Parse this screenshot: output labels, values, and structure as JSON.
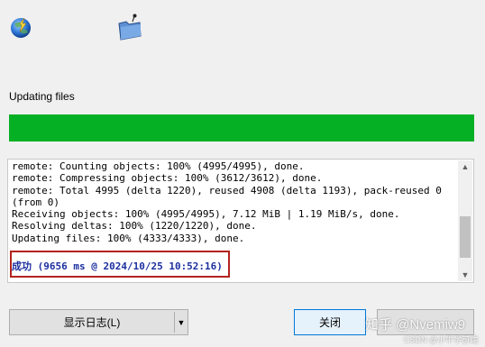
{
  "header": {
    "icons": [
      "tortoise-git-globe-icon",
      "remote-folder-icon"
    ]
  },
  "status": {
    "label": "Updating files",
    "progress_fraction": 1.0,
    "progress_color": "#06b025"
  },
  "log": {
    "lines": [
      "remote: Counting objects: 100% (4995/4995), done.",
      "remote: Compressing objects: 100% (3612/3612), done.",
      "remote: Total 4995 (delta 1220), reused 4908 (delta 1193), pack-reused 0",
      "(from 0)",
      "Receiving objects: 100% (4995/4995), 7.12 MiB | 1.19 MiB/s, done.",
      "Resolving deltas: 100% (1220/1220), done.",
      "Updating files: 100% (4333/4333), done."
    ],
    "success_line": "成功 (9656 ms @ 2024/10/25 10:52:16)",
    "success_color": "#1b2fa0",
    "highlight_color": "#b3221e"
  },
  "buttons": {
    "show_log": "显示日志(L)",
    "close": "关闭"
  },
  "watermark": {
    "main": "知乎 @Nvemiw9",
    "sub": "CSDN @小牛学前端"
  }
}
